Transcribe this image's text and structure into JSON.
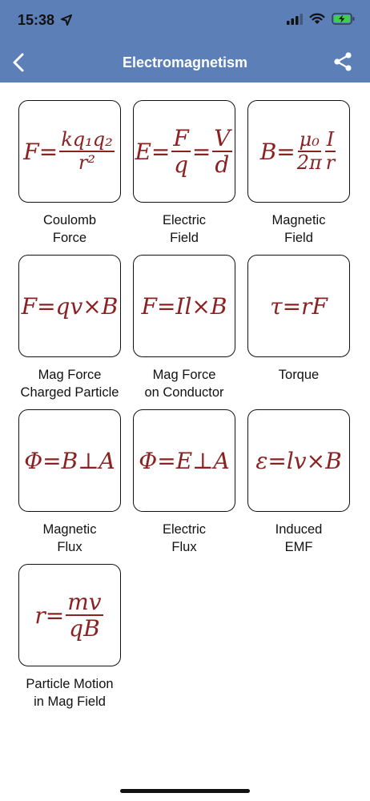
{
  "status": {
    "time": "15:38"
  },
  "nav": {
    "title": "Electromagnetism"
  },
  "formulas": [
    {
      "label1": "Coulomb",
      "label2": "Force",
      "lhs": "F=",
      "num": "kq₁q₂",
      "den": "r²"
    },
    {
      "label1": "Electric",
      "label2": "Field",
      "lhs": "E=",
      "num1": "F",
      "den1": "q",
      "mid": "=",
      "num2": "V",
      "den2": "d"
    },
    {
      "label1": "Magnetic",
      "label2": "Field",
      "lhs": "B=",
      "num1": "μ₀",
      "den1": "2π",
      "num2": "I",
      "den2": "r"
    },
    {
      "label1": "Mag Force",
      "label2": "Charged Particle",
      "text": "F=qv×B"
    },
    {
      "label1": "Mag Force",
      "label2": "on Conductor",
      "text": "F=Il×B"
    },
    {
      "label1": "Torque",
      "label2": "",
      "text": "τ=rF"
    },
    {
      "label1": "Magnetic",
      "label2": "Flux",
      "text": "Φ=B⊥A"
    },
    {
      "label1": "Electric",
      "label2": "Flux",
      "text": "Φ=E⊥A"
    },
    {
      "label1": "Induced",
      "label2": "EMF",
      "text": "ε=lv×B"
    },
    {
      "label1": "Particle Motion",
      "label2": "in Mag Field",
      "lhs": "r=",
      "num": "mv",
      "den": "qB"
    }
  ],
  "colors": {
    "nav_bg": "#5c7fb8",
    "formula": "#8b2121"
  },
  "icons": [
    "location-arrow-icon",
    "signal-icon",
    "wifi-icon",
    "battery-charging-icon",
    "back-chevron-icon",
    "share-icon"
  ]
}
